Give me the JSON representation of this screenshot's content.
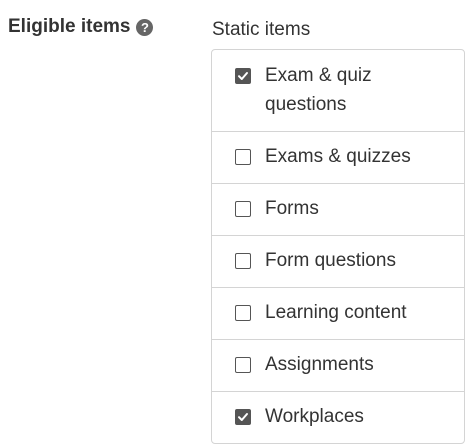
{
  "field": {
    "label": "Eligible items",
    "help_icon": "question-circle-icon"
  },
  "group": {
    "title": "Static items"
  },
  "items": [
    {
      "label": "Exam & quiz questions",
      "checked": true
    },
    {
      "label": "Exams & quizzes",
      "checked": false
    },
    {
      "label": "Forms",
      "checked": false
    },
    {
      "label": "Form questions",
      "checked": false
    },
    {
      "label": "Learning content",
      "checked": false
    },
    {
      "label": "Assignments",
      "checked": false
    },
    {
      "label": "Workplaces",
      "checked": true
    }
  ],
  "colors": {
    "text": "#333333",
    "border": "#d4d4d4",
    "checkbox": "#555555"
  }
}
